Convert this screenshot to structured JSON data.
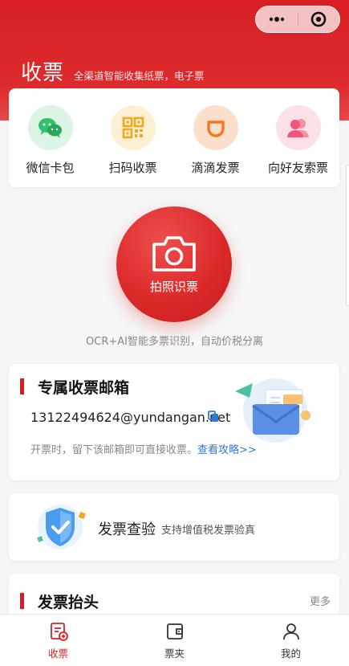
{
  "header": {
    "title": "收票",
    "subtitle": "全渠道智能收集纸票，电子票"
  },
  "quick_actions": [
    {
      "label": "微信卡包",
      "icon": "wechat-icon",
      "color": "#34c16b"
    },
    {
      "label": "扫码收票",
      "icon": "qr-code-icon",
      "color": "#f2a81a"
    },
    {
      "label": "滴滴发票",
      "icon": "didi-icon",
      "color": "#f5781f"
    },
    {
      "label": "向好友索票",
      "icon": "friends-icon",
      "color": "#f0557a"
    }
  ],
  "camera": {
    "label": "拍照识票",
    "note": "OCR+AI智能多票识别，自动价税分离"
  },
  "email_section": {
    "title": "专属收票邮箱",
    "address": "13122494624@yundangan.net",
    "hint": "开票时，留下该邮箱即可直接收票。",
    "link": "查看攻略>>"
  },
  "verify": {
    "title": "发票查验",
    "description": "支持增值税发票验真"
  },
  "invoice_header": {
    "title": "发票抬头",
    "more": "更多"
  },
  "tabbar": [
    {
      "label": "收票",
      "icon": "receive-invoice-icon",
      "active": true
    },
    {
      "label": "票夹",
      "icon": "wallet-icon",
      "active": false
    },
    {
      "label": "我的",
      "icon": "user-icon",
      "active": false
    }
  ],
  "colors": {
    "brand_red": "#d71f23",
    "link_blue": "#2d7ad6"
  }
}
